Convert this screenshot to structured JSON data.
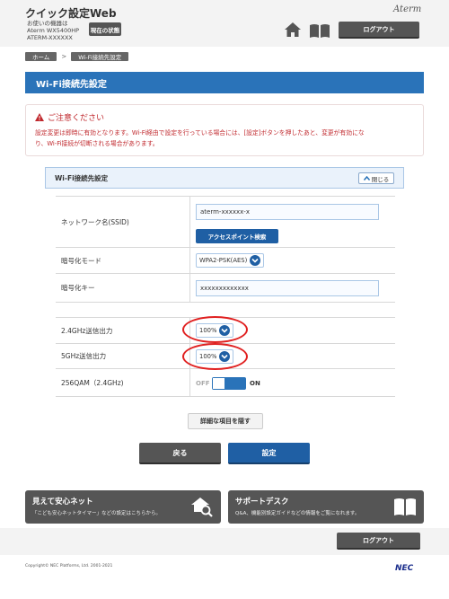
{
  "header": {
    "app_title": "クイック設定Web",
    "device_line1": "お使いの機器は",
    "device_line2": "Aterm WX5400HP",
    "device_line3": "ATERM-XXXXXX",
    "status_button": "現在の状態",
    "brand": "Aterm",
    "logout": "ログアウト"
  },
  "breadcrumb": {
    "home": "ホーム",
    "separator": ">",
    "current": "Wi-Fi接続先設定"
  },
  "page_title": "Wi-Fi接続先設定",
  "notice": {
    "title": "ご注意ください",
    "line1": "設定変更は即時に有効となります。Wi-Fi経由で設定を行っている場合には、[設定]ボタンを押したあと、変更が有効にな",
    "line2": "り、Wi-Fi接続が切断される場合があります。"
  },
  "section": {
    "title": "Wi-Fi接続先設定",
    "close_label": "閉じる"
  },
  "form": {
    "ssid_label": "ネットワーク名(SSID)",
    "ssid_value": "aterm-xxxxxx-x",
    "ap_search": "アクセスポイント検索",
    "enc_mode_label": "暗号化モード",
    "enc_mode_value": "WPA2-PSK(AES)",
    "enc_key_label": "暗号化キー",
    "enc_key_value": "xxxxxxxxxxxxx",
    "power24_label": "2.4GHz送信出力",
    "power24_value": "100%",
    "power5_label": "5GHz送信出力",
    "power5_value": "100%",
    "qam_label": "256QAM（2.4GHz)",
    "qam_off": "OFF",
    "qam_on": "ON"
  },
  "buttons": {
    "detail_hide": "詳細な項目を隠す",
    "back": "戻る",
    "apply": "設定"
  },
  "banners": {
    "left_title": "見えて安心ネット",
    "left_sub": "「こども安心ネットタイマー」などの設定はこちらから。",
    "right_title": "サポートデスク",
    "right_sub": "Q&A、機能別設定ガイドなどの情報をご覧になれます。"
  },
  "footer": {
    "logout": "ログアウト",
    "copyright": "Copyright© NEC Platforms, Ltd. 2001-2021",
    "nec": "NEC"
  },
  "colors": {
    "accent_blue": "#2a73b9",
    "dark_button": "#555555",
    "warning_red": "#c0282d",
    "highlight_red": "#e02020"
  }
}
